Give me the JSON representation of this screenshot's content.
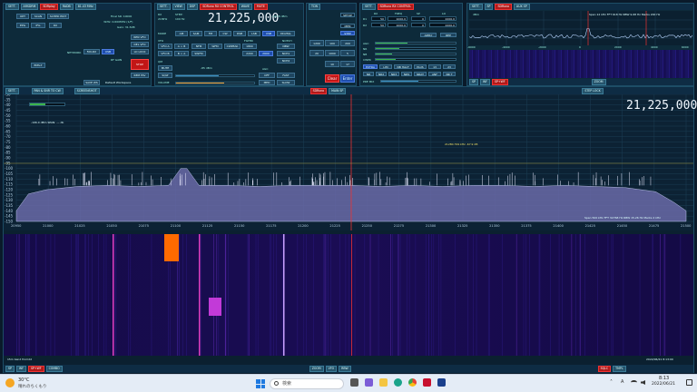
{
  "colors": {
    "bg": "#0a1a2a",
    "panel": "#0d2a3a",
    "accent": "#e33",
    "spectrum_fill": "#6a6aa8",
    "waterfall_bg": "#1a0c4a"
  },
  "top_left": {
    "title_badges": [
      "SETT.",
      "ARSDRM",
      "SDRplay",
      "RADB",
      "81.43 MHz"
    ],
    "btn_opt": "OPT",
    "btn_scan": "SCAN",
    "btn_sched": "SCHED EDIT",
    "btn_epg": "EPG",
    "btn_ifg": "IFG",
    "btn_rx": "RX",
    "info_lines": [
      "Final SR: 10000",
      "3kHz: 0.600MHz (1/F)",
      "Gain: 31.5dB"
    ],
    "btn_ren_vfo": "REN VFO",
    "btn_del_vfo": "DEL VFO",
    "btn_lo_lock": "LO LOCK",
    "btn_stop": "STOP",
    "btn_rem_fav": "REM FAV",
    "network_label": "NETWORK",
    "btn_net_a": "FAV-RX",
    "btn_net_b": "USB",
    "rf_gain": "RF GAIN",
    "btn_ems": "EMS-T",
    "btn_save_ws": "SAVE WS",
    "workspace": "Default Workspace"
  },
  "vfo_panel": {
    "title_badges": [
      "SETT.",
      "VIEW",
      "DSP",
      "SDRuno RX CONTROL",
      "WAVE",
      "MUTE",
      "TCW"
    ],
    "rx_label": "RX",
    "freq_label_a": "21MHz",
    "freq_label_b": "STEP:",
    "step": "100 Hz",
    "frequency": "21,225,000",
    "dbm": "-120.8 dBm",
    "mode_label": "MODE",
    "modes": [
      "AM",
      "SAM",
      "FM",
      "CW",
      "DSB",
      "LSB",
      "USB",
      "DIGITAL"
    ],
    "vfo_label": "VFO",
    "vfo_a": "VFO A",
    "vfo_ab": "A > B",
    "vfo_b": "VFO B",
    "vfo_ba": "B > A",
    "qm_label": "QM",
    "qm_btns": [
      "NFM",
      "WFM",
      "SWFM"
    ],
    "qm_vals": [
      "WFM",
      "SWFM"
    ],
    "cwpeak": "CWPEAK",
    "filter_label": "FILTER",
    "filters": [
      "1800",
      "2200",
      "2600"
    ],
    "notch": "NOTCH",
    "notch_btns": [
      "NBW",
      "NCH1",
      "NCH2"
    ],
    "agc_label": "AGC",
    "agc_off": "OFF",
    "agc_fast": "FAST",
    "agc_med": "MED",
    "agc_slow": "SLOW",
    "nb": "NB",
    "nr": "NR",
    "mute_btn": "MUTE",
    "sql_label": "SQL",
    "squelch": "-85 dBm",
    "volume": "VOLUME",
    "sq_btn": "SQLT",
    "bmode": "BMODE",
    "sqlt": "SQL",
    "keypad": [
      "7",
      "8",
      "9",
      "4",
      "5",
      "6",
      "1",
      "2",
      "3",
      "0",
      ".",
      "BKSP"
    ],
    "kp_right": [
      "SETUP",
      "MEM",
      "STEP"
    ],
    "kp_vals": [
      "1200",
      "100",
      "200",
      "20",
      "1000",
      "5",
      "10",
      "17"
    ],
    "btn_clear": "Clear",
    "btn_enter": "Enter"
  },
  "right_mid": {
    "title_badges": [
      "SETT.",
      "SDRuno RX CONTROL"
    ],
    "col_rx": "RX",
    "col_freq": "FREQ",
    "col_sp": "SP",
    "col_lo": "LO",
    "rows": [
      {
        "name": "R1",
        "a": "50",
        "b": "1000.0",
        "c": "0",
        "d": "2200.0"
      },
      {
        "name": "R2",
        "a": "50",
        "b": "1000.0",
        "c": "0",
        "d": "2200.0"
      }
    ],
    "btn_apply": "APPLY",
    "btn_rep": "REP",
    "sliders": [
      "AGC",
      "NR",
      "NB",
      "CWPK"
    ],
    "nb_btns": [
      "EXTRA",
      "LIM",
      "NB HALF",
      "PLUS",
      "13",
      "23"
    ],
    "nr_btns": [
      "NR",
      "NR2",
      "NR3",
      "NRS",
      "NRAT",
      "ANF",
      "NR T"
    ],
    "pre_label": "PRE MIX"
  },
  "spectrum_small": {
    "title_badges": [
      "SETT.",
      "SP",
      "SDRuno",
      "AUX SP"
    ],
    "level_label": "dBm",
    "info": "Span 12 kHz  FFT 618 Hz  RBW 9.68 Hz  Marks 200 Hz",
    "ticks": [
      "-6000",
      "-4000",
      "-2000",
      "0",
      "2000",
      "4000",
      "6000"
    ],
    "bottom_btns": [
      "SP",
      "WF",
      "SP+WF"
    ],
    "zoom": "ZOOM"
  },
  "main_panel": {
    "toolbar": [
      "SETT.",
      "PAN & SNR TO CW",
      "SCREENSHOT"
    ],
    "title_badges": [
      "SDRuno",
      "MAIN SP"
    ],
    "step_lock": "STEP LOCK",
    "top_frequency": "21,225,000",
    "y_ticks": [
      "-30",
      "-35",
      "-40",
      "-45",
      "-50",
      "-55",
      "-60",
      "-65",
      "-70",
      "-75",
      "-80",
      "-85",
      "-90",
      "-95",
      "-100",
      "-105",
      "-110",
      "-115",
      "-120",
      "-125",
      "-130",
      "-135",
      "-140",
      "-145",
      "-150"
    ],
    "level_display": "-106.0 dBm   SPAN: --- db",
    "cursor_readout": "21280.799 kHz  -67.9 dB",
    "x_ticks": [
      "20950",
      "21000",
      "21025",
      "21050",
      "21075",
      "21100",
      "21125",
      "21150",
      "21175",
      "21200",
      "21225",
      "21250",
      "21275",
      "21300",
      "21325",
      "21350",
      "21375",
      "21400",
      "21425",
      "21450",
      "21475",
      "21500"
    ],
    "span_info": "Span 500 kHz  FFT 32768 Hz  RBW 15.26 Hz  Marks 2 kHz",
    "timestamp": "2022/06/21 8:13:00",
    "waterfall_label": "15m band fromdd",
    "bottom_btns": [
      "SP",
      "WF",
      "SP+WF",
      "COMBO"
    ],
    "zoom_label": "ZOOM",
    "vfo_label": "VFO",
    "rbw_label": "RBW",
    "right_btns": [
      "SQLC",
      "TMPL"
    ]
  },
  "chart_data": {
    "type": "area",
    "title": "",
    "xlabel": "",
    "ylabel": "",
    "xlim": [
      20950,
      21500
    ],
    "ylim": [
      -150,
      -30
    ],
    "marker_frequency": 21225,
    "x": [
      20950,
      20960,
      20975,
      21000,
      21025,
      21050,
      21075,
      21085,
      21090,
      21100,
      21125,
      21150,
      21175,
      21200,
      21225,
      21250,
      21275,
      21300,
      21325,
      21350,
      21375,
      21400,
      21425,
      21450,
      21475,
      21490,
      21500
    ],
    "values": [
      -140,
      -124,
      -120,
      -117,
      -116,
      -117,
      -116,
      -100,
      -100,
      -116,
      -116,
      -117,
      -116,
      -116,
      -116,
      -117,
      -116,
      -117,
      -116,
      -116,
      -117,
      -116,
      -117,
      -118,
      -122,
      -132,
      -140
    ]
  },
  "taskbar": {
    "weather_temp": "30°C",
    "weather_text": "晴れのちくもり",
    "search_placeholder": "検索",
    "tray_lang": "A",
    "time": "8:13",
    "date": "2022/06/21"
  }
}
